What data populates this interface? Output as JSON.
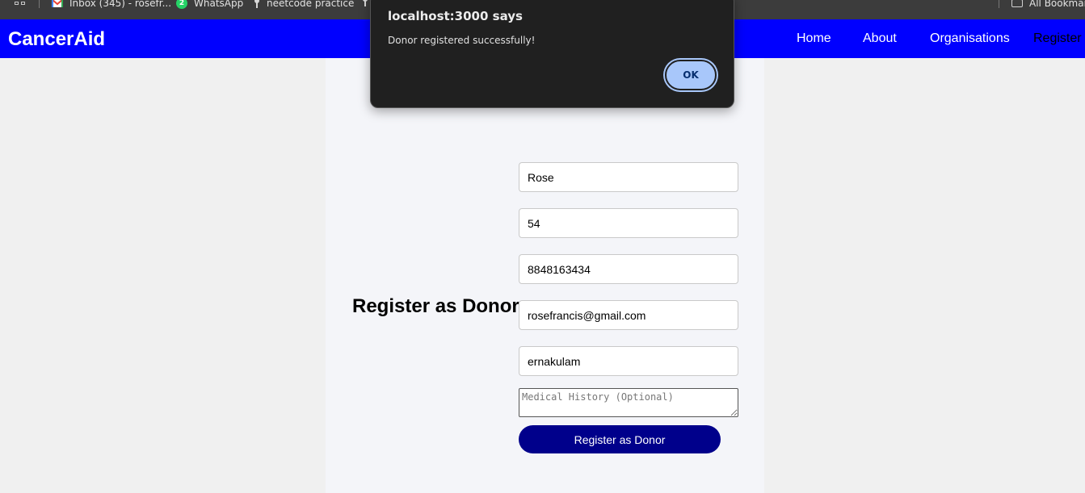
{
  "bookmarks": {
    "items": [
      {
        "label": "Inbox (345) - rosefr...",
        "icon": "gmail-icon"
      },
      {
        "label": "WhatsApp",
        "icon": "whatsapp-icon",
        "badge": "2"
      },
      {
        "label": "neetcode practice",
        "icon": "pin-icon"
      }
    ],
    "all_bookmarks": "All Bookmarks"
  },
  "navbar": {
    "brand": "CancerAid",
    "links": [
      "Home",
      "About",
      "Organisations",
      "Register"
    ],
    "background": "#0000ff"
  },
  "form": {
    "title": "Register as Donor",
    "fields": {
      "name": "Rose",
      "age": "54",
      "phone": "8848163434",
      "email": "rosefrancis@gmail.com",
      "location": "ernakulam"
    },
    "medical_placeholder": "Medical History (Optional)",
    "submit_label": "Register as Donor",
    "button_color": "#00008b"
  },
  "dialog": {
    "title": "localhost:3000 says",
    "message": "Donor registered successfully!",
    "ok_label": "OK"
  }
}
